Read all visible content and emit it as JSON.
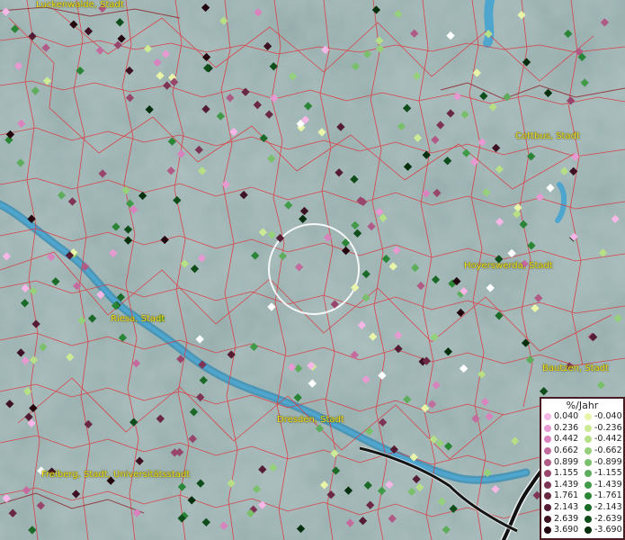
{
  "map": {
    "places": [
      {
        "name": "Luckenwalde, Stadt"
      },
      {
        "name": "Cottbus, Stadt"
      },
      {
        "name": "Hoyerswerda, Stadt"
      },
      {
        "name": "Riesa, Stadt"
      },
      {
        "name": "Bautzen, Stadt"
      },
      {
        "name": "Dresden, Stadt"
      },
      {
        "name": "Freiberg, Stadt, Universitätsstadt"
      }
    ]
  },
  "legend": {
    "title": "%/Jahr",
    "positive": {
      "values": [
        "0.040",
        "0.236",
        "0.442",
        "0.662",
        "0.899",
        "1.155",
        "1.439",
        "1.761",
        "2.143",
        "2.639",
        "3.690"
      ],
      "colors": [
        "#f6b6e6",
        "#e79ad2",
        "#d883bd",
        "#c46b9e",
        "#b05a86",
        "#98466c",
        "#7e3455",
        "#6a2842",
        "#551d33",
        "#3d1223",
        "#24060f"
      ]
    },
    "negative": {
      "values": [
        "-0.040",
        "-0.236",
        "-0.442",
        "-0.662",
        "-0.899",
        "-1.155",
        "-1.439",
        "-1.761",
        "-2.143",
        "-2.639",
        "-3.690"
      ],
      "colors": [
        "#e8f4a8",
        "#cdea96",
        "#b6df86",
        "#95d07a",
        "#7ac06c",
        "#5dad5c",
        "#409a48",
        "#2a8636",
        "#1b6a28",
        "#0f4d1a",
        "#06300d"
      ]
    }
  }
}
